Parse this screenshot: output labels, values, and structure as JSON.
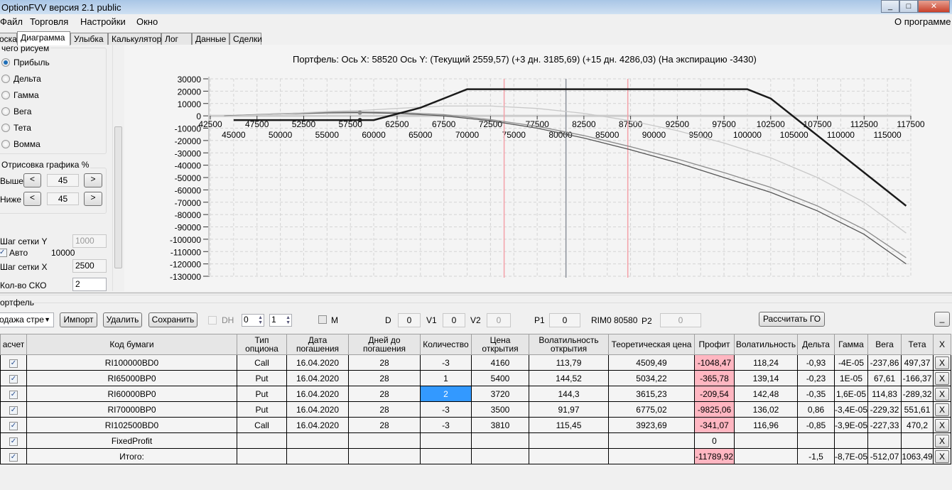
{
  "window": {
    "title": "OptionFVV версия 2.1 public",
    "controls": [
      "_",
      "□",
      "✕"
    ]
  },
  "menu": {
    "items": [
      "Файл",
      "Торговля",
      "Настройки",
      "Окно"
    ],
    "about": "О программе"
  },
  "tabs": [
    "оска",
    "Диаграмма",
    "Улыбка",
    "Калькулятор",
    "Лог",
    "Данные",
    "Сделки"
  ],
  "active_tab": "Диаграмма",
  "left": {
    "draw_group": "чего рисуем",
    "radios": [
      "Прибыль",
      "Дельта",
      "Гамма",
      "Вега",
      "Тета",
      "Вомма"
    ],
    "selected": "Прибыль",
    "render_group": "Отрисовка графика %",
    "above_label": "Выше",
    "above_value": "45",
    "below_label": "Ниже",
    "below_value": "45",
    "dec": "<",
    "inc": ">",
    "grid_y_label": "Шаг сетки Y",
    "grid_y_value": "1000",
    "auto_label": "Авто",
    "auto_checked": true,
    "auto_value": "10000",
    "grid_x_label": "Шаг сетки X",
    "grid_x_value": "2500",
    "sko_label": "Кол-во СКО",
    "sko_value": "2"
  },
  "chart_data": {
    "type": "line",
    "title": "Портфель: Ось X: 58520 Ось Y:  (Текущий 2559,57)  (+3 дн. 3185,69)  (+15 дн. 4286,03)  (На экспирацию -3430)",
    "xlim": [
      42500,
      117500
    ],
    "ylim": [
      -130000,
      30000
    ],
    "x_ticks_top": [
      42500,
      47500,
      52500,
      57500,
      62500,
      67500,
      72500,
      77500,
      82500,
      87500,
      92500,
      97500,
      102500,
      107500,
      112500,
      117500
    ],
    "x_ticks_bottom": [
      45000,
      50000,
      55000,
      60000,
      65000,
      70000,
      75000,
      80000,
      85000,
      90000,
      95000,
      100000,
      105000,
      110000,
      115000
    ],
    "y_ticks": [
      30000,
      20000,
      10000,
      0,
      -10000,
      -20000,
      -30000,
      -40000,
      -50000,
      -60000,
      -70000,
      -80000,
      -90000,
      -100000,
      -110000,
      -120000,
      -130000
    ],
    "grid": true,
    "vlines": [
      {
        "x": 73960,
        "color": "#f4a0a8"
      },
      {
        "x": 80580,
        "color": "#8a8f99"
      },
      {
        "x": 87200,
        "color": "#f4a0a8"
      }
    ],
    "marker_x": 58520,
    "series": [
      {
        "key": "expiry",
        "color": "#1a1a1a",
        "width": 2.5,
        "points": [
          [
            45000,
            -3430
          ],
          [
            60000,
            -3430
          ],
          [
            65000,
            6570
          ],
          [
            70000,
            21570
          ],
          [
            100000,
            21570
          ],
          [
            102500,
            14070
          ],
          [
            117000,
            -72930
          ]
        ]
      },
      {
        "key": "plus15",
        "color": "#c8c8c8",
        "width": 1.3,
        "points": [
          [
            44000,
            -500
          ],
          [
            50000,
            1500
          ],
          [
            55000,
            3500
          ],
          [
            58520,
            4286
          ],
          [
            62500,
            6000
          ],
          [
            67500,
            8000
          ],
          [
            72500,
            8000
          ],
          [
            77500,
            6000
          ],
          [
            82500,
            2000
          ],
          [
            87500,
            -4000
          ],
          [
            92500,
            -12000
          ],
          [
            97500,
            -22000
          ],
          [
            102500,
            -34000
          ],
          [
            107500,
            -50000
          ],
          [
            112500,
            -70000
          ],
          [
            117000,
            -95000
          ]
        ]
      },
      {
        "key": "plus3",
        "color": "#8c8c8c",
        "width": 1.3,
        "points": [
          [
            44000,
            0
          ],
          [
            50000,
            1800
          ],
          [
            55000,
            2900
          ],
          [
            58520,
            3186
          ],
          [
            62500,
            2800
          ],
          [
            67500,
            1000
          ],
          [
            72500,
            -3000
          ],
          [
            77500,
            -8500
          ],
          [
            82500,
            -16000
          ],
          [
            87500,
            -25000
          ],
          [
            92500,
            -35000
          ],
          [
            97500,
            -46000
          ],
          [
            102500,
            -58000
          ],
          [
            107500,
            -73000
          ],
          [
            112500,
            -92000
          ],
          [
            117000,
            -115000
          ]
        ]
      },
      {
        "key": "current",
        "color": "#555555",
        "width": 1.3,
        "points": [
          [
            44000,
            0
          ],
          [
            50000,
            1500
          ],
          [
            55000,
            2400
          ],
          [
            58520,
            2560
          ],
          [
            62500,
            2000
          ],
          [
            67500,
            0
          ],
          [
            72500,
            -4000
          ],
          [
            77500,
            -10000
          ],
          [
            82500,
            -18000
          ],
          [
            87500,
            -27500
          ],
          [
            92500,
            -38000
          ],
          [
            97500,
            -50000
          ],
          [
            102500,
            -62000
          ],
          [
            107500,
            -77000
          ],
          [
            112500,
            -96000
          ],
          [
            117000,
            -120000
          ]
        ]
      }
    ],
    "markers": [
      {
        "x": 58520,
        "y": 2560,
        "color": "#888888"
      },
      {
        "x": 58520,
        "y": -3430,
        "color": "#222222"
      }
    ]
  },
  "portfolio": {
    "group": "ортфель",
    "strategy": "одажа стре",
    "import": "Импорт",
    "delete": "Удалить",
    "save": "Сохранить",
    "dh": "DH",
    "spin1": "0",
    "spin2": "1",
    "m": "M",
    "d_label": "D",
    "d": "0",
    "v1_label": "V1",
    "v1": "0",
    "v2_label": "V2",
    "v2": "0",
    "p1_label": "P1",
    "p1": "0",
    "rim": "RIM0 80580",
    "p2_label": "P2",
    "p2": "0",
    "calc_go": "Рассчитать ГО",
    "minimize": "_"
  },
  "table": {
    "headers": [
      "асчет",
      "Код бумаги",
      "Тип опциона",
      "Дата погашения",
      "Дней до погашения",
      "Количество",
      "Цена открытия",
      "Волатильность открытия",
      "Теоретическая цена",
      "Профит",
      "Волатильность",
      "Дельта",
      "Гамма",
      "Вега",
      "Тета",
      "X"
    ],
    "rows": [
      [
        "RI100000BD0",
        "Call",
        "16.04.2020",
        "28",
        "-3",
        "4160",
        "113,79",
        "4509,49",
        "-1048,47",
        "118,24",
        "-0,93",
        "-4E-05",
        "-237,86",
        "497,37"
      ],
      [
        "RI65000BP0",
        "Put",
        "16.04.2020",
        "28",
        "1",
        "5400",
        "144,52",
        "5034,22",
        "-365,78",
        "139,14",
        "-0,23",
        "1E-05",
        "67,61",
        "-166,37"
      ],
      [
        "RI60000BP0",
        "Put",
        "16.04.2020",
        "28",
        "2",
        "3720",
        "144,3",
        "3615,23",
        "-209,54",
        "142,48",
        "-0,35",
        "1,6E-05",
        "114,83",
        "-289,32"
      ],
      [
        "RI70000BP0",
        "Put",
        "16.04.2020",
        "28",
        "-3",
        "3500",
        "91,97",
        "6775,02",
        "-9825,06",
        "136,02",
        "0,86",
        "-3,4E-05",
        "-229,32",
        "551,61"
      ],
      [
        "RI102500BD0",
        "Call",
        "16.04.2020",
        "28",
        "-3",
        "3810",
        "115,45",
        "3923,69",
        "-341,07",
        "116,96",
        "-0,85",
        "-3,9E-05",
        "-227,33",
        "470,2"
      ],
      [
        "FixedProfit",
        "",
        "",
        "",
        "",
        "",
        "",
        "",
        "0",
        "",
        "",
        "",
        "",
        ""
      ],
      [
        "Итого:",
        "",
        "",
        "",
        "",
        "",
        "",
        "",
        "-11789,92",
        "",
        "-1,5",
        "-8,7E-05",
        "-512,07",
        "1063,49"
      ]
    ],
    "x_label": "X",
    "check": "✓"
  }
}
